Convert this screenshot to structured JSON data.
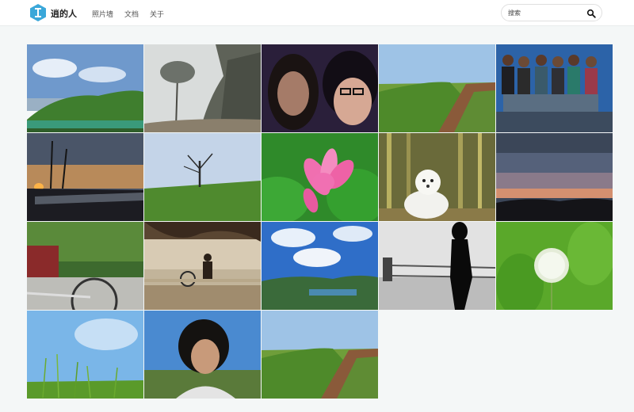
{
  "header": {
    "site_name": "逍的人",
    "nav": [
      "照片墙",
      "文档",
      "关于"
    ],
    "search_placeholder": "搜索"
  },
  "colors": {
    "logo": "#3aa7d9",
    "nav_bg": "#ffffff",
    "page_bg": "#f4f7f7"
  },
  "gallery": {
    "photos": [
      {
        "subject": "lake-shore"
      },
      {
        "subject": "misty-tree"
      },
      {
        "subject": "couple-selfie"
      },
      {
        "subject": "wheat-field-path"
      },
      {
        "subject": "group-of-kids"
      },
      {
        "subject": "sunset-bare-tree"
      },
      {
        "subject": "lone-tree-field"
      },
      {
        "subject": "pink-lotus"
      },
      {
        "subject": "white-puppy"
      },
      {
        "subject": "dusk-sky"
      },
      {
        "subject": "bicycle-park"
      },
      {
        "subject": "sepia-riverbank"
      },
      {
        "subject": "blue-sky-lake"
      },
      {
        "subject": "silhouette-girl"
      },
      {
        "subject": "dandelion"
      },
      {
        "subject": "grass-sky"
      },
      {
        "subject": "boy-portrait"
      },
      {
        "subject": "field-path"
      }
    ]
  }
}
